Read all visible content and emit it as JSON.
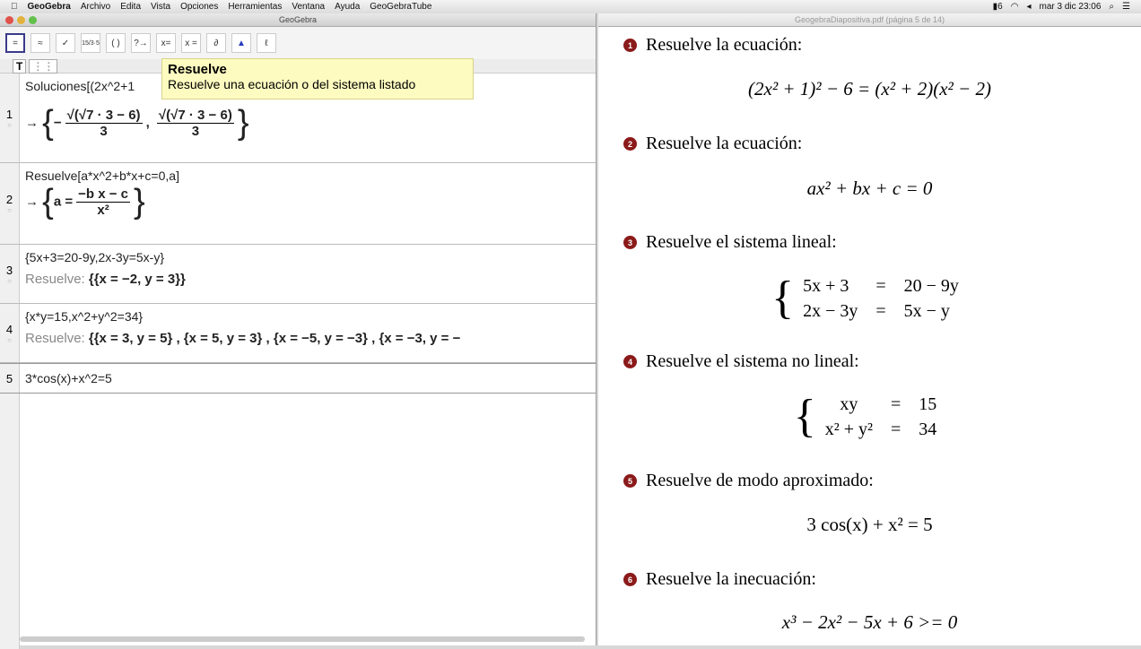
{
  "menubar": {
    "app": "GeoGebra",
    "items": [
      "Archivo",
      "Edita",
      "Vista",
      "Opciones",
      "Herramientas",
      "Ventana",
      "Ayuda",
      "GeoGebraTube"
    ],
    "clock": "mar 3 dic  23:06",
    "battery_label": "6"
  },
  "geogebra": {
    "title": "GeoGebra",
    "toolbar": [
      "=",
      "≈",
      "✓",
      "15/3·5",
      "( )",
      "?→",
      "x=",
      "x =",
      "∂",
      "▲",
      "ℓ"
    ],
    "tooltip": {
      "title": "Resuelve",
      "text": "Resuelve una ecuación o del sistema listado"
    },
    "rows": [
      {
        "n": "1",
        "input": "Soluciones[(2x^2+1",
        "out_arrow": "→",
        "sol1_num": "√(√7 · 3 − 6)",
        "sol_den": "3",
        "sol2_num": "√(√7 · 3 − 6)"
      },
      {
        "n": "2",
        "input": "Resuelve[a*x^2+b*x+c=0,a]",
        "out_arrow": "→",
        "lhs": "a =",
        "num": "−b x − c",
        "den": "x²"
      },
      {
        "n": "3",
        "input": "{5x+3=20-9y,2x-3y=5x-y}",
        "label": "Resuelve:",
        "output": "{{x = −2, y = 3}}"
      },
      {
        "n": "4",
        "input": "{x*y=15,x^2+y^2=34}",
        "label": "Resuelve:",
        "output": "{{x = 3, y = 5} , {x = 5, y = 3} , {x = −5, y = −3} , {x = −3, y = −"
      },
      {
        "n": "5",
        "input": "3*cos(x)+x^2=5"
      }
    ]
  },
  "pdf": {
    "title": "GeogebraDiapositiva.pdf (página 5 de 14)",
    "items": [
      {
        "n": "1",
        "text": "Resuelve la ecuación:",
        "eq": "(2x² + 1)² − 6 = (x² + 2)(x² − 2)"
      },
      {
        "n": "2",
        "text": "Resuelve la ecuación:",
        "eq": "ax² + bx + c = 0"
      },
      {
        "n": "3",
        "text": "Resuelve el sistema lineal:",
        "sys": [
          [
            "5x + 3",
            "=",
            "20 − 9y"
          ],
          [
            "2x − 3y",
            "=",
            "5x − y"
          ]
        ]
      },
      {
        "n": "4",
        "text": "Resuelve el sistema no lineal:",
        "sys": [
          [
            "xy",
            "=",
            "15"
          ],
          [
            "x² + y²",
            "=",
            "34"
          ]
        ]
      },
      {
        "n": "5",
        "text": "Resuelve de modo aproximado:",
        "eq": "3 cos(x) + x² = 5"
      },
      {
        "n": "6",
        "text": "Resuelve la inecuación:",
        "eq": "x³ − 2x² − 5x + 6 >= 0"
      }
    ]
  }
}
